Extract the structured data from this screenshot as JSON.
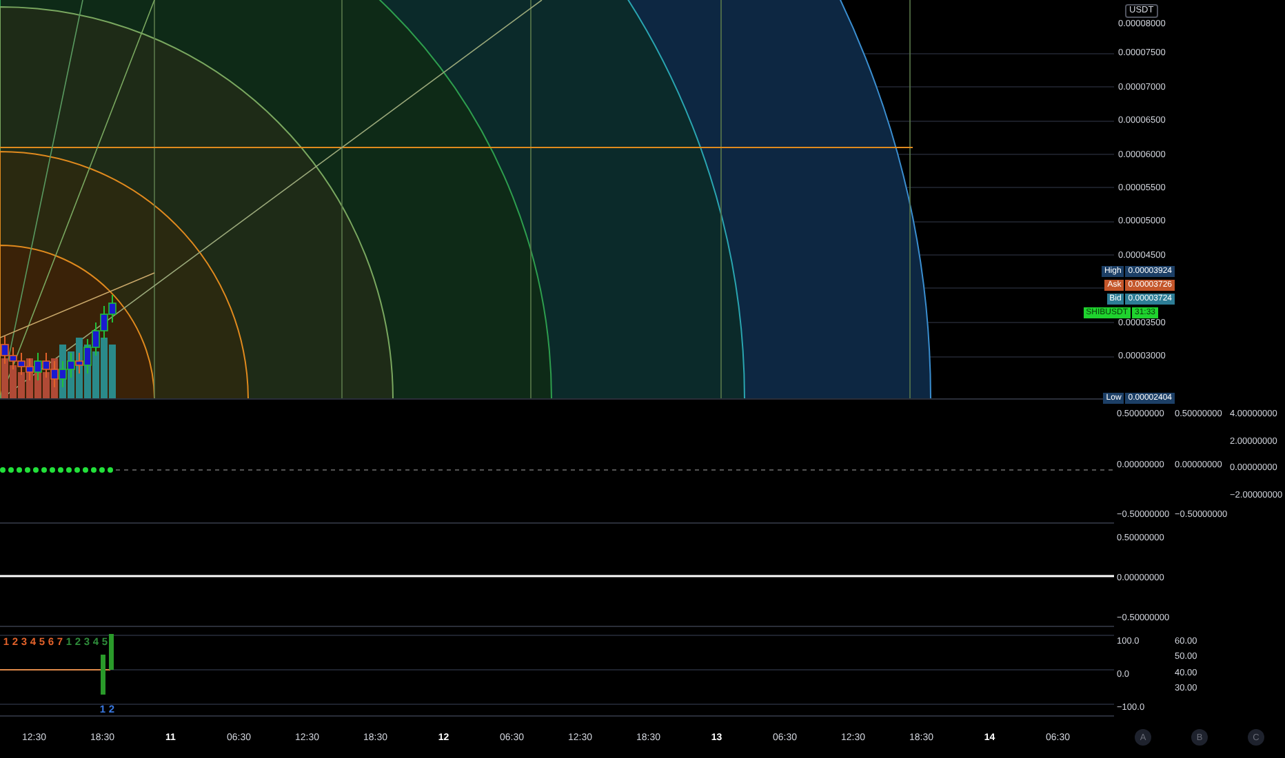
{
  "price_axis": {
    "currency": "USDT",
    "ticks": [
      "0.00008000",
      "0.00007500",
      "0.00007000",
      "0.00006500",
      "0.00006000",
      "0.00005500",
      "0.00005000",
      "0.00004500",
      "0.00003500",
      "0.00003000"
    ]
  },
  "price_tags": [
    {
      "kind": "high",
      "label": "High",
      "value": "0.00003924"
    },
    {
      "kind": "ask",
      "label": "Ask",
      "value": "0.00003726"
    },
    {
      "kind": "bid",
      "label": "Bid",
      "value": "0.00003724"
    },
    {
      "kind": "symbol",
      "label": "SHIBUSDT",
      "value": "31:33"
    },
    {
      "kind": "low",
      "label": "Low",
      "value": "0.00002404"
    }
  ],
  "panes": [
    {
      "kind": "dots",
      "axes": [
        [
          "0.50000000",
          "0.00000000",
          "−0.50000000"
        ],
        [
          "0.50000000",
          "0.00000000",
          "−0.50000000"
        ],
        [
          "4.00000000",
          "2.00000000",
          "0.00000000",
          "−2.00000000"
        ]
      ]
    },
    {
      "kind": "line",
      "axes": [
        [
          "0.50000000",
          "0.00000000",
          "−0.50000000"
        ]
      ]
    },
    {
      "kind": "bars",
      "axes": [
        [
          "100.0",
          "0.0",
          "−100.0"
        ],
        [
          "60.00",
          "50.00",
          "40.00",
          "30.00"
        ]
      ]
    }
  ],
  "count_labels": [
    {
      "text": "1",
      "color": "#e0612a"
    },
    {
      "text": "2",
      "color": "#e0612a"
    },
    {
      "text": "3",
      "color": "#e0612a"
    },
    {
      "text": "4",
      "color": "#e0612a"
    },
    {
      "text": "5",
      "color": "#e0612a"
    },
    {
      "text": "6",
      "color": "#e0612a"
    },
    {
      "text": "7",
      "color": "#e0612a"
    },
    {
      "text": "1",
      "color": "#2e8b3a"
    },
    {
      "text": "2",
      "color": "#2e8b3a"
    },
    {
      "text": "3",
      "color": "#2e8b3a"
    },
    {
      "text": "4",
      "color": "#2e8b3a"
    },
    {
      "text": "5",
      "color": "#2e8b3a"
    }
  ],
  "lower_counts": [
    {
      "text": "1",
      "color": "#3a78e0"
    },
    {
      "text": "2",
      "color": "#3a78e0"
    }
  ],
  "time_axis": [
    {
      "label": "12:30",
      "kind": "time"
    },
    {
      "label": "18:30",
      "kind": "time"
    },
    {
      "label": "11",
      "kind": "date"
    },
    {
      "label": "06:30",
      "kind": "time"
    },
    {
      "label": "12:30",
      "kind": "time"
    },
    {
      "label": "18:30",
      "kind": "time"
    },
    {
      "label": "12",
      "kind": "date"
    },
    {
      "label": "06:30",
      "kind": "time"
    },
    {
      "label": "12:30",
      "kind": "time"
    },
    {
      "label": "18:30",
      "kind": "time"
    },
    {
      "label": "13",
      "kind": "date"
    },
    {
      "label": "06:30",
      "kind": "time"
    },
    {
      "label": "12:30",
      "kind": "time"
    },
    {
      "label": "18:30",
      "kind": "time"
    },
    {
      "label": "14",
      "kind": "date"
    },
    {
      "label": "06:30",
      "kind": "time"
    }
  ],
  "scale_buttons": [
    "A",
    "B",
    "C"
  ]
}
